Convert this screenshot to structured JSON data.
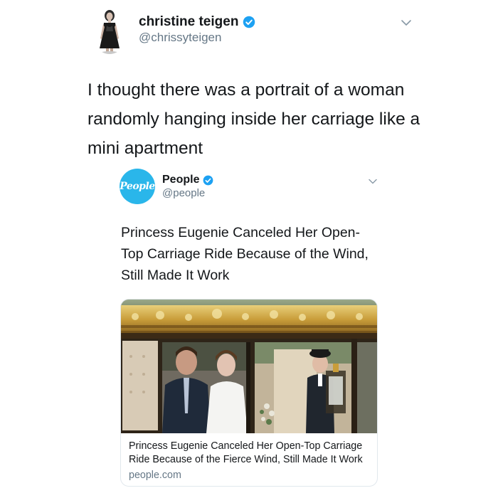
{
  "tweet": {
    "author_name": "christine teigen",
    "author_handle": "@chrissyteigen",
    "text": "I thought there was a portrait of a woman randomly hanging inside her carriage like a mini apartment",
    "menu_icon": "chevron-down-icon",
    "verified_icon": "verified-badge-icon"
  },
  "quoted_tweet": {
    "author_name": "People",
    "author_handle": "@people",
    "avatar_text": "People",
    "text": "Princess Eugenie Canceled Her Open-Top Carriage Ride Because of the Wind, Still Made It Work",
    "menu_icon": "chevron-down-icon",
    "verified_icon": "verified-badge-icon",
    "card": {
      "title": "Princess Eugenie Canceled Her Open-Top Carriage Ride Because of the Fierce Wind, Still Made It Work",
      "domain": "people.com"
    }
  },
  "colors": {
    "text_primary": "#14171a",
    "text_secondary": "#657786",
    "verified_blue": "#1da1f2",
    "people_brand": "#2ab6ea",
    "card_border": "#e1e8ed"
  }
}
